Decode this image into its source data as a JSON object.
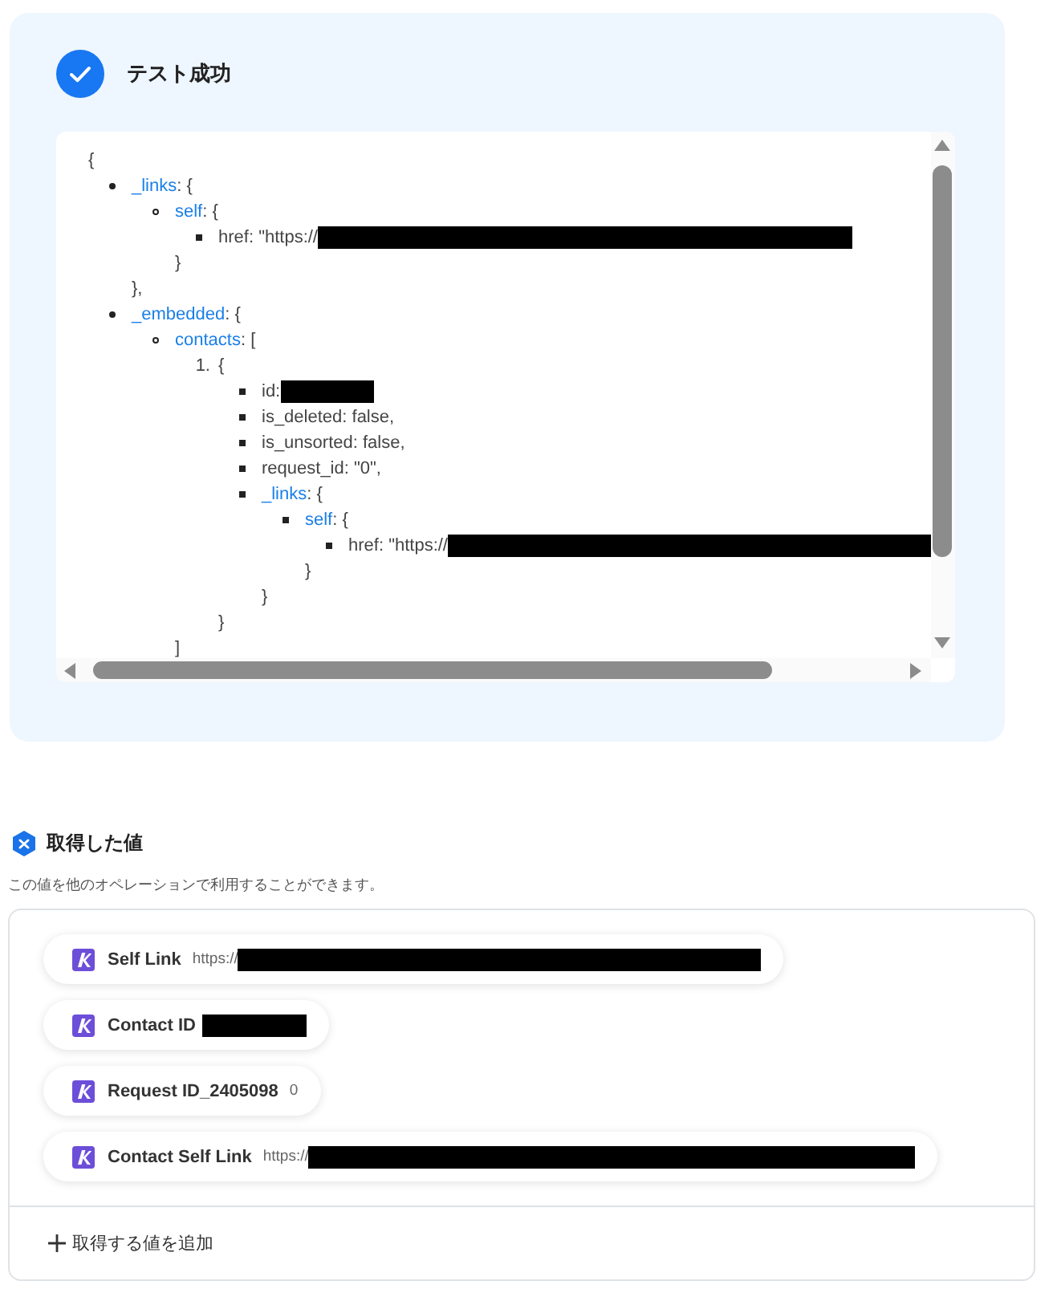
{
  "test_result": {
    "success": true,
    "title": "テスト成功",
    "tree": [
      {
        "text": "{",
        "children": [
          {
            "key": "_links",
            "text": ": {",
            "close": "},",
            "children": [
              {
                "key": "self",
                "text": ": {",
                "close": "}",
                "children": [
                  {
                    "text": "href: \"https://",
                    "redacted": true
                  }
                ]
              }
            ]
          },
          {
            "key": "_embedded",
            "text": ": {",
            "children": [
              {
                "key": "contacts",
                "text": ": [",
                "close": "]",
                "children": [
                  {
                    "marker": "1.",
                    "text": "{",
                    "close": "}",
                    "children": [
                      {
                        "text": "id:",
                        "redacted": true
                      },
                      {
                        "text": "is_deleted: false,"
                      },
                      {
                        "text": "is_unsorted: false,"
                      },
                      {
                        "text": "request_id: \"0\","
                      },
                      {
                        "key": "_links",
                        "text": ": {",
                        "close": "}",
                        "children": [
                          {
                            "key": "self",
                            "text": ": {",
                            "close": "}",
                            "children": [
                              {
                                "text": "href: \"https://",
                                "redacted": true
                              }
                            ]
                          }
                        ]
                      }
                    ]
                  }
                ]
              }
            ]
          }
        ]
      }
    ]
  },
  "obtained_values": {
    "title": "取得した値",
    "description": "この値を他のオペレーションで利用することができます。",
    "items": [
      {
        "label": "Self Link",
        "value": "https://",
        "redacted": true
      },
      {
        "label": "Contact ID",
        "redacted": true
      },
      {
        "label": "Request ID_2405098",
        "value": "0",
        "redacted": false
      },
      {
        "label": "Contact Self Link",
        "value": "https://",
        "redacted": true
      }
    ],
    "add_button": "取得する値を追加"
  }
}
